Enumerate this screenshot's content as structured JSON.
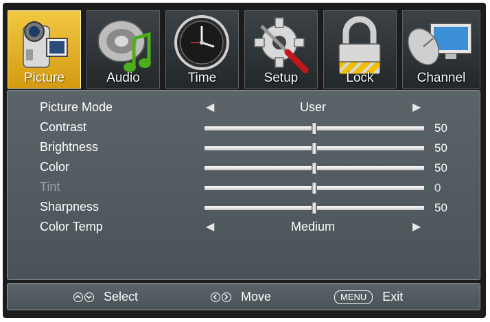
{
  "tabs": [
    {
      "label": "Picture",
      "icon": "camcorder-icon",
      "active": true
    },
    {
      "label": "Audio",
      "icon": "speaker-music-note-icon",
      "active": false
    },
    {
      "label": "Time",
      "icon": "clock-icon",
      "active": false
    },
    {
      "label": "Setup",
      "icon": "gear-screwdriver-icon",
      "active": false
    },
    {
      "label": "Lock",
      "icon": "padlock-icon",
      "active": false
    },
    {
      "label": "Channel",
      "icon": "satellite-dish-monitor-icon",
      "active": false
    }
  ],
  "settings": [
    {
      "label": "Picture Mode",
      "type": "option",
      "value": "User"
    },
    {
      "label": "Contrast",
      "type": "slider",
      "value": 50,
      "disabled": false
    },
    {
      "label": "Brightness",
      "type": "slider",
      "value": 50,
      "disabled": false
    },
    {
      "label": "Color",
      "type": "slider",
      "value": 50,
      "disabled": false
    },
    {
      "label": "Tint",
      "type": "slider",
      "value": 0,
      "disabled": true
    },
    {
      "label": "Sharpness",
      "type": "slider",
      "value": 50,
      "disabled": false
    },
    {
      "label": "Color Temp",
      "type": "option",
      "value": "Medium"
    }
  ],
  "footer": {
    "select_label": "Select",
    "move_label": "Move",
    "menu_key": "MENU",
    "exit_label": "Exit"
  },
  "colors": {
    "active_tab": "#e6b42a",
    "panel_bg": "#525b60",
    "frame_bg": "#1c1c1c"
  }
}
